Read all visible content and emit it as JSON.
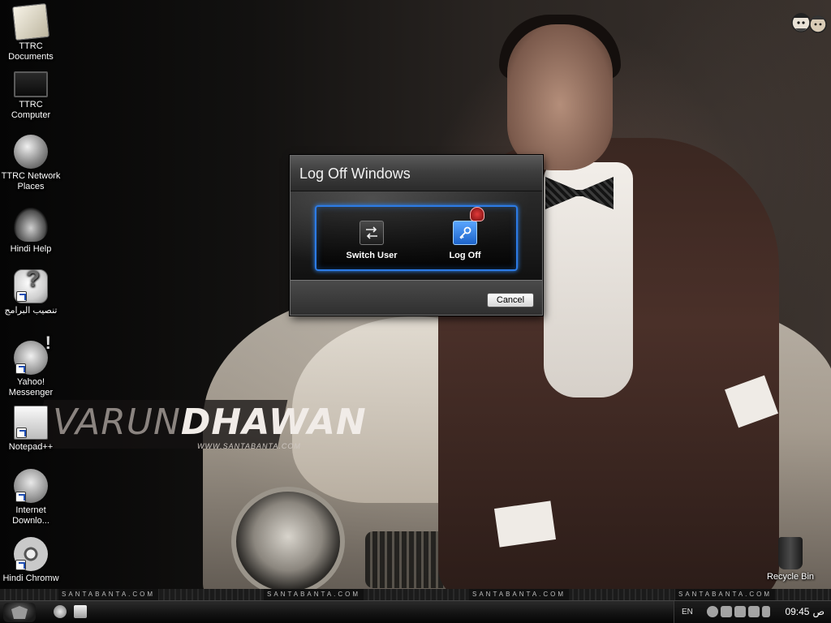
{
  "wallpaper": {
    "brand_first": "VARUN",
    "brand_last": "DHAWAN",
    "brand_url": "WWW.SANTABANTA.COM",
    "strip_text": "SANTABANTA.COM"
  },
  "desktop": {
    "icons": [
      {
        "label": "TTRC Documents",
        "icon": "documents-icon"
      },
      {
        "label": "TTRC Computer",
        "icon": "computer-icon"
      },
      {
        "label": "TTRC Network Places",
        "icon": "network-globe-icon"
      },
      {
        "label": "Hindi Help",
        "icon": "horse-logo-icon"
      },
      {
        "label": "تنصيب البرامج",
        "icon": "setup-help-icon"
      },
      {
        "label": "Yahoo! Messenger",
        "icon": "yahoo-messenger-icon"
      },
      {
        "label": "Notepad++",
        "icon": "notepad-icon"
      },
      {
        "label": "Internet Downlo...",
        "icon": "download-manager-icon"
      },
      {
        "label": "Hindi Chromw",
        "icon": "chrome-icon"
      }
    ],
    "recycle_bin": "Recycle Bin"
  },
  "dialog": {
    "title": "Log Off Windows",
    "switch_user_label": "Switch User",
    "log_off_label": "Log Off",
    "cancel_label": "Cancel",
    "accent_color": "#2c7be6"
  },
  "taskbar": {
    "language": "EN",
    "clock_time": "09:45",
    "clock_ampm": "ص"
  }
}
